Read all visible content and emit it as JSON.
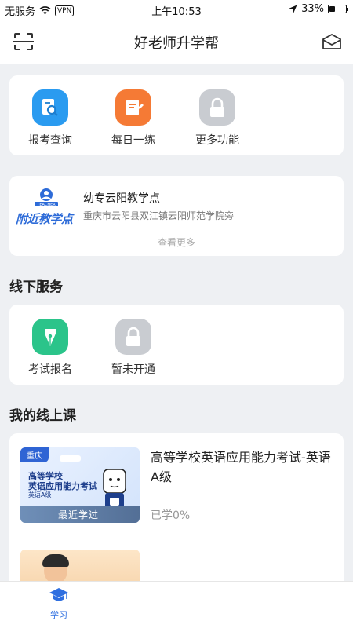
{
  "status_bar": {
    "carrier": "无服务",
    "vpn": "VPN",
    "time": "上午10:53",
    "battery": "33%",
    "battery_level": 0.33
  },
  "nav": {
    "title": "好老师升学帮",
    "left_icon": "scan-icon",
    "right_icon": "mail-icon"
  },
  "functions": [
    {
      "label": "报考查询",
      "icon": "search-doc-icon",
      "color": "#2a9bf0"
    },
    {
      "label": "每日一练",
      "icon": "notepad-icon",
      "color": "#f57a35"
    },
    {
      "label": "更多功能",
      "icon": "lock-icon",
      "color": "#c9ccd1"
    }
  ],
  "study_point": {
    "logo_text": "附近教学点",
    "logo_badge": "TEACHER",
    "name": "幼专云阳教学点",
    "address": "重庆市云阳县双江镇云阳师范学院旁",
    "more": "查看更多"
  },
  "offline": {
    "title": "线下服务",
    "items": [
      {
        "label": "考试报名",
        "icon": "pen-icon",
        "color": "#2bc48a"
      },
      {
        "label": "暂未开通",
        "icon": "lock-icon",
        "color": "#c9ccd1"
      }
    ]
  },
  "online": {
    "title": "我的线上课",
    "course": {
      "thumb_tag": "重庆",
      "thumb_line1": "高等学校",
      "thumb_line2": "英语应用能力考试",
      "thumb_line3": "英语A级",
      "thumb_recent": "最近学过",
      "title": "高等学校英语应用能力考试-英语A级",
      "progress": "已学0%"
    }
  },
  "tab_bar": {
    "items": [
      {
        "label": "学习",
        "icon": "graduation-cap-icon",
        "active": true
      }
    ],
    "active_color": "#2f6fe0"
  }
}
